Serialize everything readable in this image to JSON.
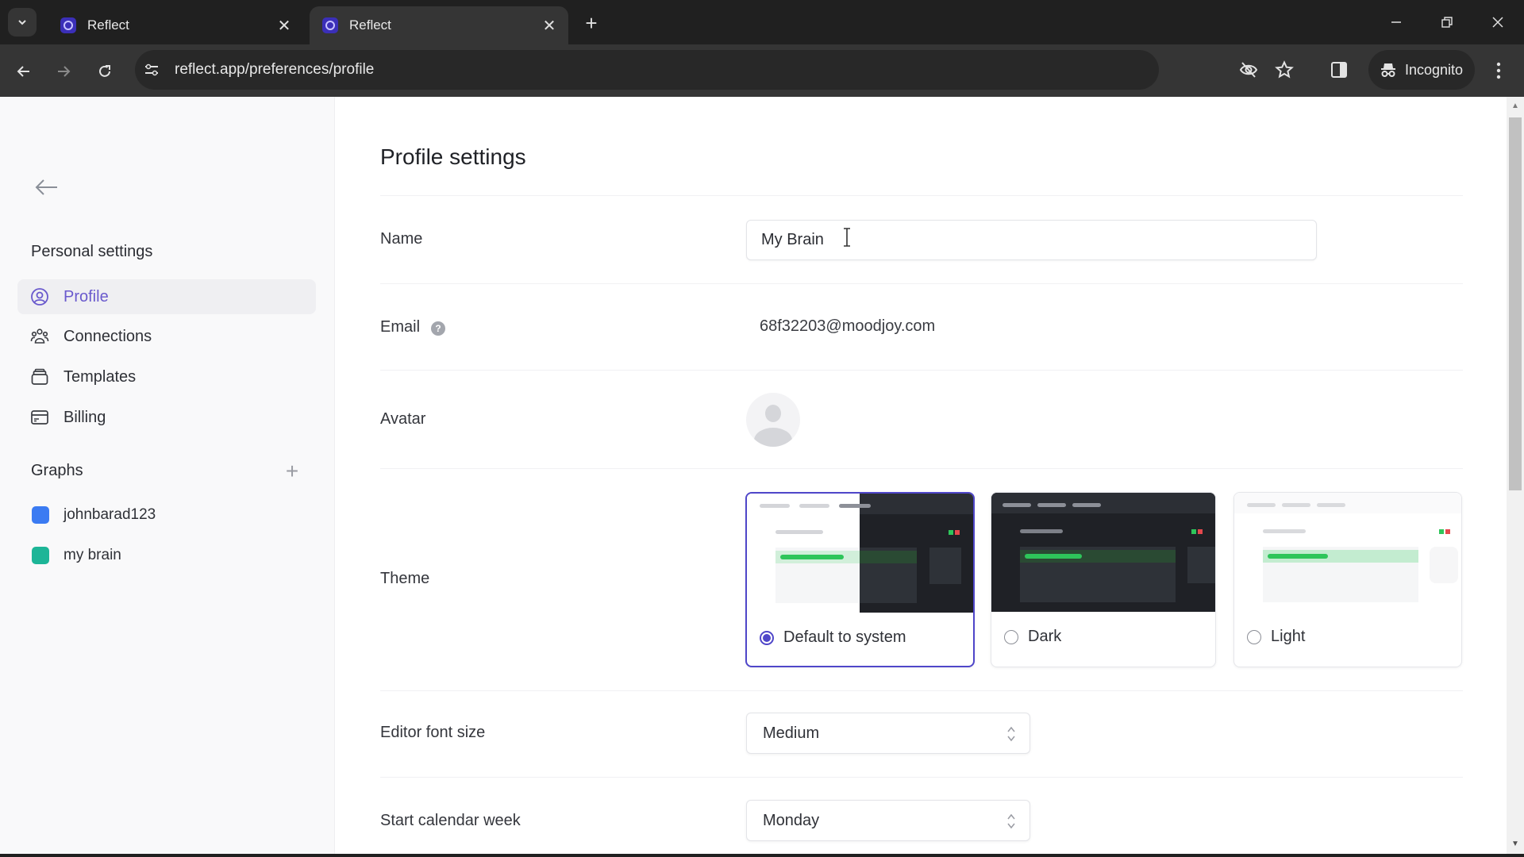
{
  "browser": {
    "tabs": [
      {
        "title": "Reflect",
        "active": false
      },
      {
        "title": "Reflect",
        "active": true
      }
    ],
    "url": "reflect.app/preferences/profile",
    "incognito_label": "Incognito",
    "icons": {
      "tab_list": "chevron-down-icon",
      "close_tab": "close-icon",
      "new_tab": "plus-icon",
      "back": "arrow-left-icon",
      "forward": "arrow-right-icon",
      "reload": "reload-icon",
      "site_info": "tune-icon",
      "eye_off": "eye-off-icon",
      "bookmark": "star-icon",
      "side_panel": "side-panel-icon",
      "incognito": "incognito-icon",
      "menu": "kebab-menu-icon",
      "minimize": "minimize-icon",
      "restore": "restore-icon",
      "close_window": "close-icon"
    },
    "tab_close_glyph": "✕",
    "new_tab_glyph": "+"
  },
  "sidebar": {
    "personal_heading": "Personal settings",
    "items": [
      {
        "label": "Profile",
        "icon": "user-circle-icon",
        "active": true
      },
      {
        "label": "Connections",
        "icon": "users-icon",
        "active": false
      },
      {
        "label": "Templates",
        "icon": "template-icon",
        "active": false
      },
      {
        "label": "Billing",
        "icon": "credit-card-icon",
        "active": false
      }
    ],
    "graphs_heading": "Graphs",
    "add_graph_glyph": "+",
    "graphs": [
      {
        "label": "johnbarad123",
        "color": "#3b7bf2"
      },
      {
        "label": "my brain",
        "color": "#1db597"
      }
    ]
  },
  "main": {
    "title": "Profile settings",
    "name": {
      "label": "Name",
      "value": "My Brain"
    },
    "email": {
      "label": "Email",
      "value": "68f32203@moodjoy.com",
      "help_glyph": "?"
    },
    "avatar": {
      "label": "Avatar"
    },
    "theme": {
      "label": "Theme",
      "options": [
        {
          "label": "Default to system",
          "selected": true
        },
        {
          "label": "Dark",
          "selected": false
        },
        {
          "label": "Light",
          "selected": false
        }
      ]
    },
    "editor_font_size": {
      "label": "Editor font size",
      "value": "Medium"
    },
    "start_calendar_week": {
      "label": "Start calendar week",
      "value": "Monday"
    }
  },
  "colors": {
    "accent": "#4f46c9",
    "active_nav_text": "#6a5acd",
    "preview_green": "#2ec55a",
    "preview_red": "#e5484d"
  }
}
